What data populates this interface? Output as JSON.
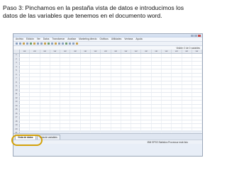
{
  "caption": {
    "line1": "Paso 3: Pinchamos en la pestaña vista de datos e introducimos los",
    "line2": "datos de las variables que tenemos en el documento word."
  },
  "spss": {
    "menu": [
      "Archivo",
      "Edición",
      "Ver",
      "Datos",
      "Transformar",
      "Analizar",
      "Marketing directo",
      "Gráficos",
      "Utilidades",
      "Ventana",
      "Ayuda"
    ],
    "visible_label": "Visible: 0 de 0 variables",
    "column_label": "var",
    "row_numbers": [
      "1",
      "2",
      "3",
      "4",
      "5",
      "6",
      "7",
      "8",
      "9",
      "10",
      "11",
      "12",
      "13",
      "14",
      "15",
      "16",
      "17",
      "18",
      "19",
      "20",
      "21",
      "22"
    ],
    "tabs": {
      "data_view": "Vista de datos",
      "variable_view": "Vista de variables"
    },
    "status": "IBM SPSS Statistics Processor está listo"
  },
  "colors": {
    "highlight": "#d4a20a"
  }
}
